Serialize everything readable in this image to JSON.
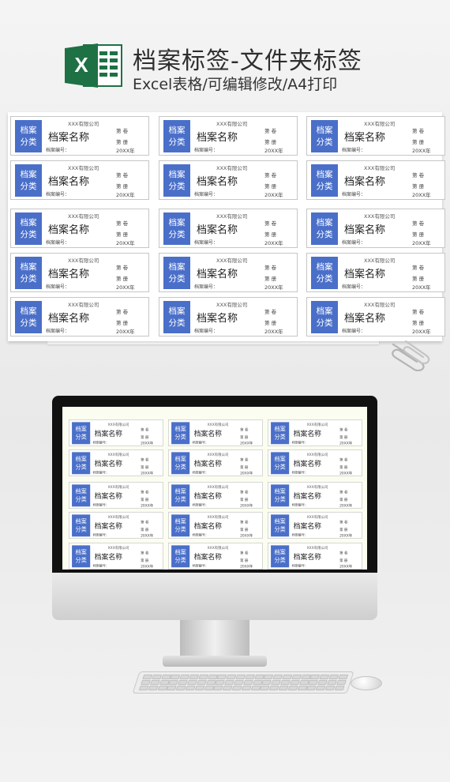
{
  "header": {
    "logo_letter": "X",
    "title": "档案标签-文件夹标签",
    "subtitle": "Excel表格/可编辑修改/A4打印"
  },
  "label": {
    "category_line1": "档案",
    "category_line2": "分类",
    "company": "XXX有限公司",
    "name": "档案名称",
    "volume": "第    卷",
    "book": "第    册",
    "number_label": "档案编号：",
    "year": "20XX年"
  },
  "colors": {
    "accent_blue": "#4a6fc9",
    "monitor_bezel": "#111111",
    "excel_green": "#1e7145"
  },
  "icons": [
    "excel-icon",
    "paper-clip-icon",
    "monitor-icon",
    "keyboard-icon",
    "mouse-icon"
  ]
}
